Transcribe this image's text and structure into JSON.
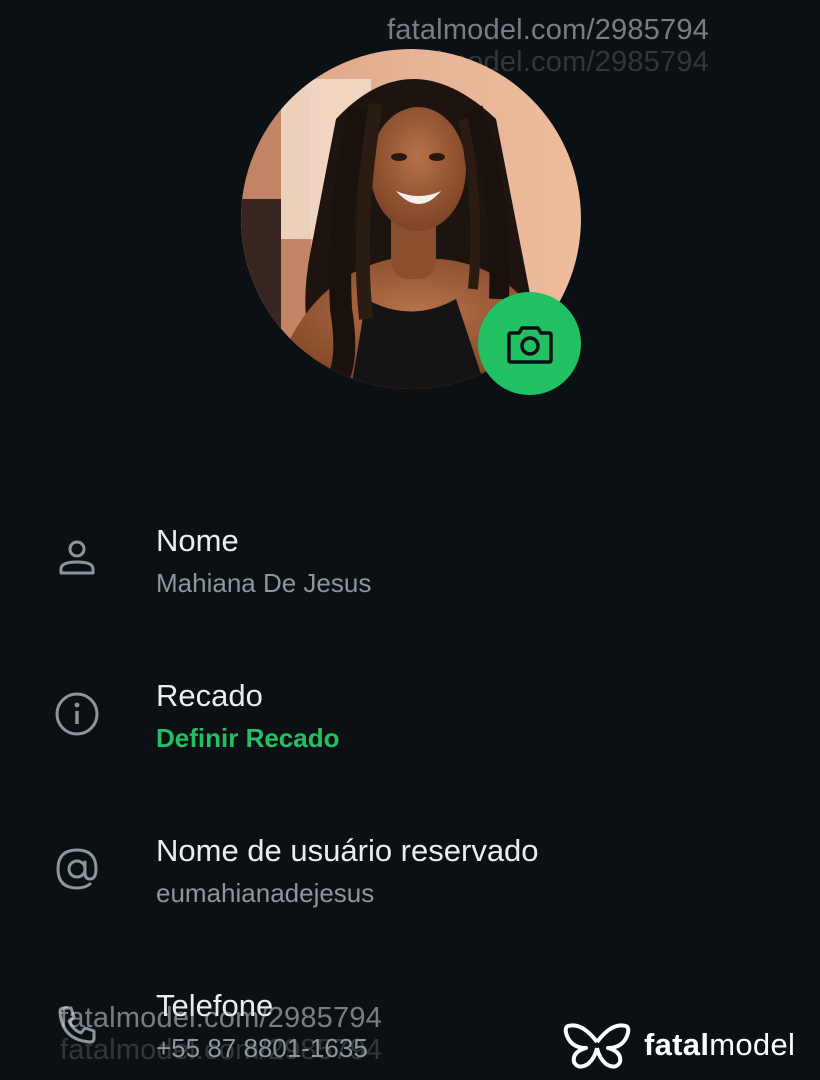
{
  "profile": {
    "photo_alt": "Mahiana De Jesus"
  },
  "rows": [
    {
      "title": "Nome",
      "value": "Mahiana De Jesus",
      "icon": "person-icon"
    },
    {
      "title": "Recado",
      "value": "Definir Recado",
      "icon": "info-icon"
    },
    {
      "title": "Nome de usuário reservado",
      "value": "eumahianadejesus",
      "icon": "at-icon"
    },
    {
      "title": "Telefone",
      "value": "+55 87 8801-1635",
      "icon": "phone-icon"
    }
  ],
  "watermark": {
    "url": "fatalmodel.com/2985794",
    "brand_bold": "fatal",
    "brand_rest": "model"
  },
  "colors": {
    "background": "#0b1014",
    "accent": "#21c063",
    "muted": "#8d969b"
  }
}
